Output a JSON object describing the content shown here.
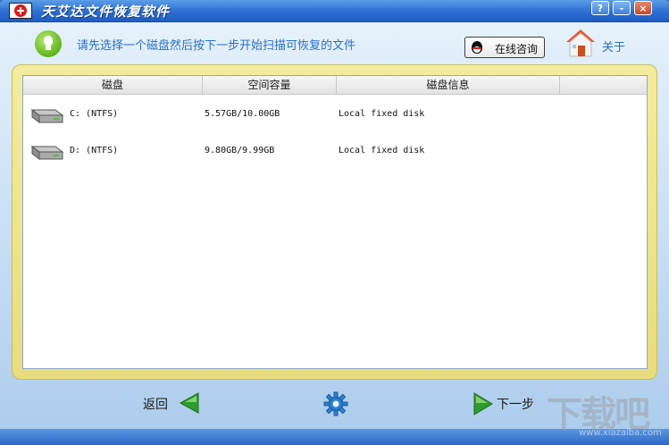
{
  "window": {
    "title": "天艾达文件恢复软件",
    "controls": {
      "help": "?",
      "minimize": "-",
      "close": "×"
    }
  },
  "header": {
    "instruction": "请先选择一个磁盘然后按下一步开始扫描可恢复的文件",
    "consult_button": "在线咨询",
    "about_link": "关于"
  },
  "table": {
    "columns": [
      "磁盘",
      "空间容量",
      "磁盘信息",
      ""
    ],
    "rows": [
      {
        "name": "C:  (NTFS)",
        "space": "5.57GB/10.00GB",
        "info": "Local fixed disk"
      },
      {
        "name": "D:  (NTFS)",
        "space": "9.80GB/9.99GB",
        "info": "Local fixed disk"
      }
    ]
  },
  "nav": {
    "back_label": "返回",
    "next_label": "下一步"
  },
  "watermark": {
    "text": "下载吧",
    "url": "www.xiazaiba.com"
  },
  "colors": {
    "titlebar": "#2d6ed3",
    "accent_text": "#2a6fc8",
    "panel_border": "#e7dc7e",
    "arrow_green": "#2e9b2e"
  }
}
